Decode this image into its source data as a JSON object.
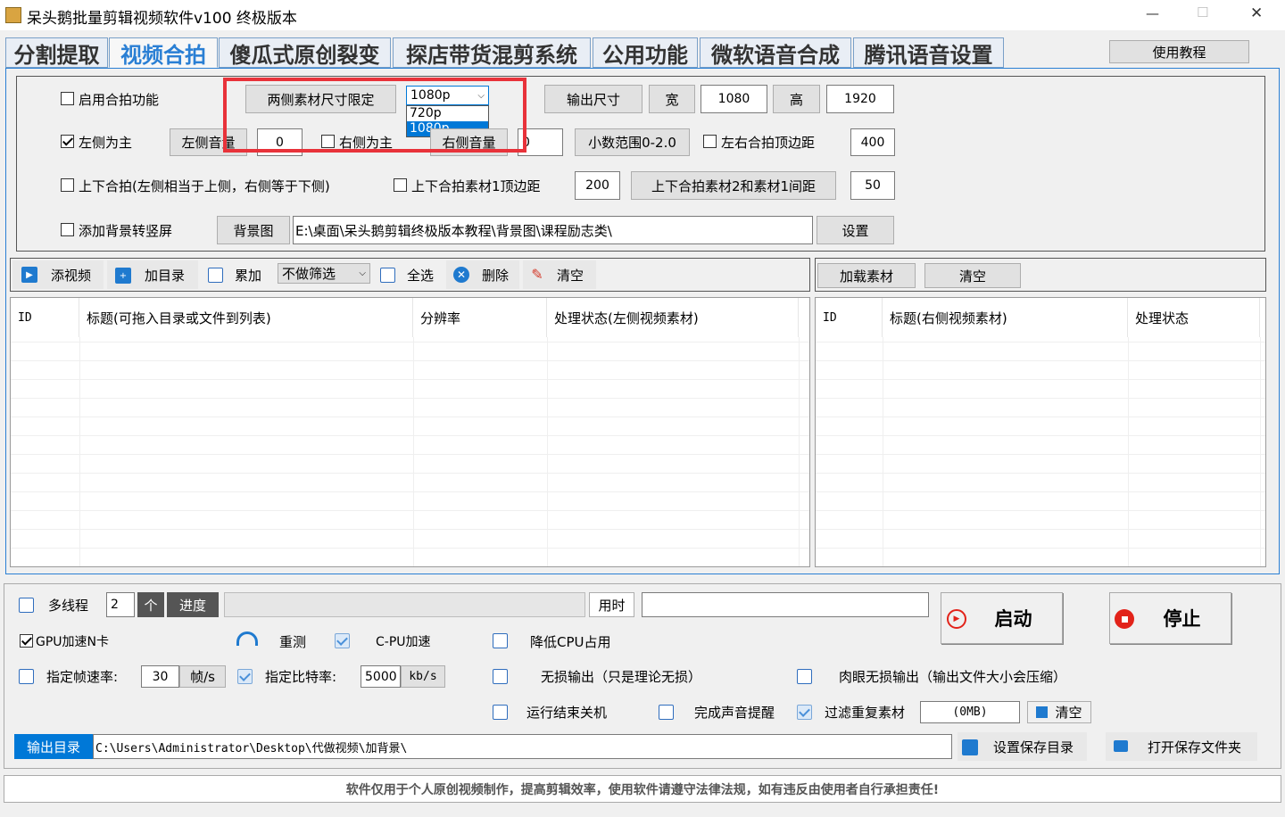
{
  "window": {
    "title": "呆头鹅批量剪辑视频软件v100 终极版本",
    "minimize": "—",
    "maximize": "☐",
    "close": "✕"
  },
  "tabs": [
    "分割提取",
    "视频合拍",
    "傻瓜式原创裂变",
    "探店带货混剪系统",
    "公用功能",
    "微软语音合成",
    "腾讯语音设置"
  ],
  "tutorial_button": "使用教程",
  "settings": {
    "enable_label": "启用合拍功能",
    "size_limit_button": "两侧素材尺寸限定",
    "size_select": {
      "value": "1080p",
      "options": [
        "720p",
        "1080p"
      ]
    },
    "output_size_button": "输出尺寸",
    "width_button": "宽",
    "width_value": "1080",
    "height_button": "高",
    "height_value": "1920",
    "left_main_label": "左侧为主",
    "left_volume_button": "左侧音量",
    "left_volume_value": "0",
    "right_main_label": "右侧为主",
    "right_volume_button": "右侧音量",
    "right_volume_value": "0",
    "decimal_range_button": "小数范围0-2.0",
    "lr_top_margin_label": "左右合拍顶边距",
    "lr_top_margin_value": "400",
    "tb_label": "上下合拍(左侧相当于上侧，右侧等于下侧)",
    "tb_top_margin_label": "上下合拍素材1顶边距",
    "tb_top_margin_value": "200",
    "tb_gap_button": "上下合拍素材2和素材1间距",
    "tb_gap_value": "50",
    "bg_label": "添加背景转竖屏",
    "bg_button": "背景图",
    "bg_path": "E:\\桌面\\呆头鹅剪辑终极版本教程\\背景图\\课程励志类\\",
    "set_button": "设置"
  },
  "toolbar_left": {
    "add_video": "添视频",
    "add_dir": "加目录",
    "accumulate": "累加",
    "filter_value": "不做筛选",
    "select_all": "全选",
    "delete": "删除",
    "clear": "清空"
  },
  "toolbar_right": {
    "load": "加载素材",
    "clear": "清空"
  },
  "left_table": {
    "headers": [
      "ID",
      "标题(可拖入目录或文件到列表)",
      "分辨率",
      "处理状态(左侧视频素材)"
    ]
  },
  "right_table": {
    "headers": [
      "ID",
      "标题(右侧视频素材)",
      "处理状态"
    ]
  },
  "bottom": {
    "multithread_label": "多线程",
    "thread_count": "2",
    "unit_button": "个",
    "progress_button": "进度",
    "progress_value": 0,
    "elapsed_button": "用时",
    "elapsed_value": "",
    "start_button": "启动",
    "stop_button": "停止",
    "gpu_label": "GPU加速N卡",
    "retest_label": "重测",
    "cpu_accel_label": "C-PU加速",
    "lower_cpu_label": "降低CPU占用",
    "fps_label": "指定帧速率:",
    "fps_value": "30",
    "fps_unit": "帧/s",
    "bitrate_label": "指定比特率:",
    "bitrate_value": "5000",
    "bitrate_unit": "kb/s",
    "lossless_label": "无损输出（只是理论无损）",
    "visual_lossless_label": "肉眼无损输出（输出文件大小会压缩）",
    "shutdown_label": "运行结束关机",
    "sound_label": "完成声音提醒",
    "dedupe_label": "过滤重复素材",
    "cache_value": "(0MB)",
    "cache_clear": "清空",
    "output_dir_button": "输出目录",
    "output_dir_value": "C:\\Users\\Administrator\\Desktop\\代做视频\\加背景\\",
    "set_save_dir": "设置保存目录",
    "open_save_dir": "打开保存文件夹"
  },
  "footer": "软件仅用于个人原创视频制作，提高剪辑效率，使用软件请遵守法律法规，如有违反由使用者自行承担责任!",
  "colors": {
    "accent": "#2a7fd4",
    "highlight": "#e8323a",
    "selection": "#0078d7"
  }
}
